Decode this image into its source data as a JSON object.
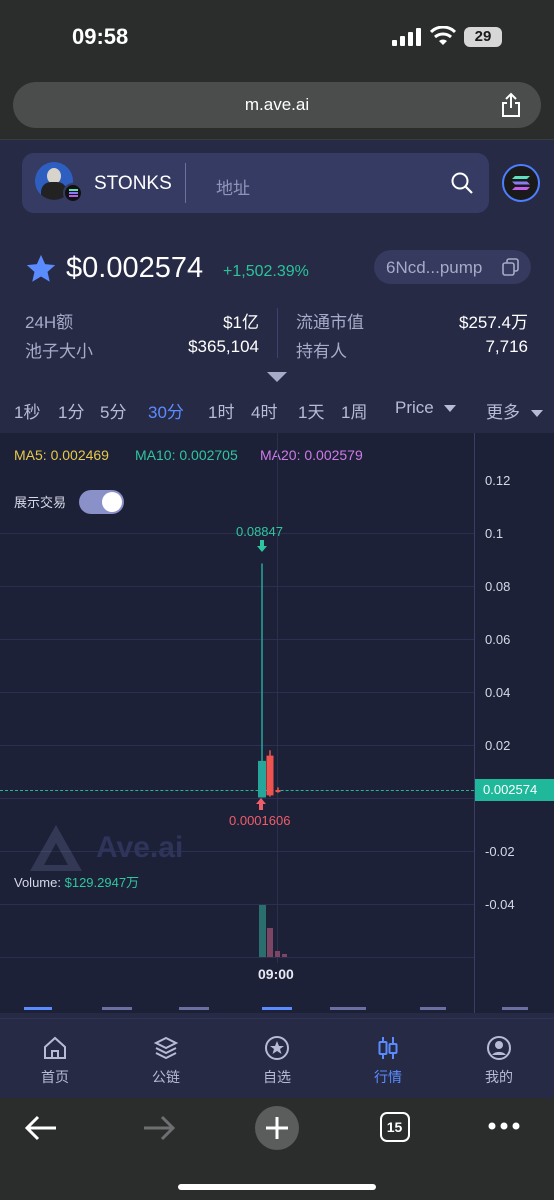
{
  "status": {
    "time": "09:58",
    "battery": "29"
  },
  "browser": {
    "url": "m.ave.ai",
    "tabs_count": "15"
  },
  "token": {
    "name": "STONKS",
    "search_placeholder": "地址",
    "price": "$0.002574",
    "change": "+1,502.39%",
    "address": "6Ncd...pump"
  },
  "stats": {
    "vol_label": "24H额",
    "vol_value": "$1亿",
    "mcap_label": "流通市值",
    "mcap_value": "$257.4万",
    "pool_label": "池子大小",
    "pool_value": "$365,104",
    "holders_label": "持有人",
    "holders_value": "7,716"
  },
  "timeframes": [
    "1秒",
    "1分",
    "5分",
    "30分",
    "1时",
    "4时",
    "1天",
    "1周"
  ],
  "active_timeframe": "30分",
  "price_dropdown": "Price",
  "more_dropdown": "更多",
  "ma": {
    "ma5": "MA5: 0.002469",
    "ma10": "MA10: 0.002705",
    "ma20": "MA20: 0.002579"
  },
  "show_trades_label": "展示交易",
  "chart_data": {
    "type": "candlestick",
    "y_ticks": [
      "0.12",
      "0.1",
      "0.08",
      "0.06",
      "0.04",
      "0.02",
      "-0.02",
      "-0.04"
    ],
    "current_price_label": "0.002574",
    "high_label": "0.08847",
    "low_label": "0.0001606",
    "x_label": "09:00",
    "volume_label": "Volume:",
    "volume_value": "$129.2947万",
    "watermark": "Ave.ai",
    "candles": [
      {
        "open": 0.0002,
        "close": 0.014,
        "high": 0.08847,
        "low": 0.0001606,
        "color": "#26a69a"
      },
      {
        "open": 0.016,
        "close": 0.001,
        "high": 0.018,
        "low": 0.0005,
        "color": "#ef5350"
      },
      {
        "open": 0.003,
        "close": 0.0025,
        "high": 0.004,
        "low": 0.002,
        "color": "#ef5350"
      }
    ]
  },
  "tabs": [
    {
      "label": "首页",
      "icon": "home-icon"
    },
    {
      "label": "公链",
      "icon": "layers-icon"
    },
    {
      "label": "自选",
      "icon": "star-circle-icon"
    },
    {
      "label": "行情",
      "icon": "candles-icon"
    },
    {
      "label": "我的",
      "icon": "user-icon"
    }
  ],
  "colors": {
    "accent": "#5b8cff",
    "up": "#26a69a",
    "down": "#ef5350",
    "price_tag": "#1fb89a"
  }
}
